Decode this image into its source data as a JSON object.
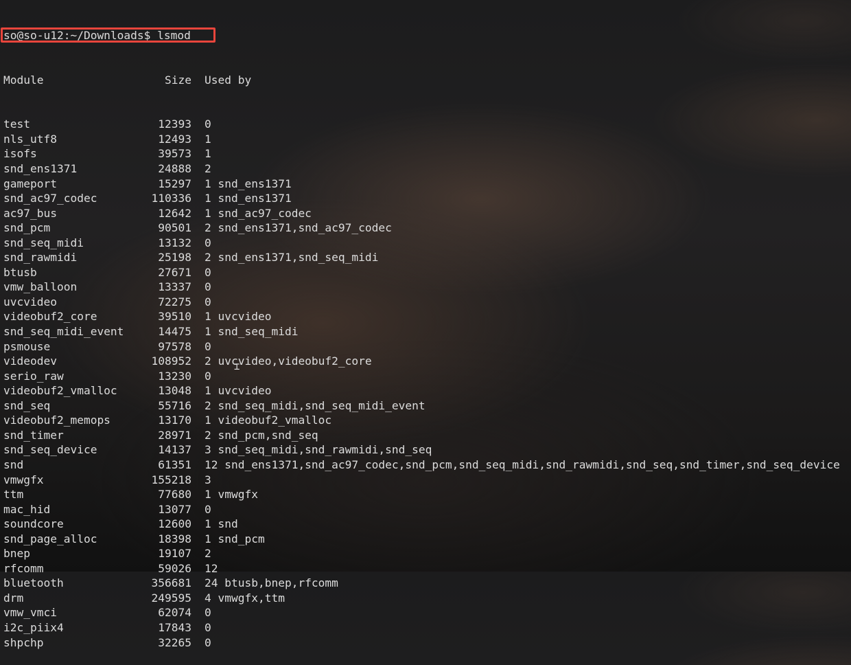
{
  "terminal": {
    "prompt": "so@so-u12:~/Downloads$ lsmod",
    "header": {
      "module": "Module",
      "size": "Size",
      "used_by": "Used by"
    },
    "highlight_color": "#e8453c",
    "rows": [
      {
        "module": "test",
        "size": "12393",
        "used_by": "0"
      },
      {
        "module": "nls_utf8",
        "size": "12493",
        "used_by": "1"
      },
      {
        "module": "isofs",
        "size": "39573",
        "used_by": "1"
      },
      {
        "module": "snd_ens1371",
        "size": "24888",
        "used_by": "2"
      },
      {
        "module": "gameport",
        "size": "15297",
        "used_by": "1 snd_ens1371"
      },
      {
        "module": "snd_ac97_codec",
        "size": "110336",
        "used_by": "1 snd_ens1371"
      },
      {
        "module": "ac97_bus",
        "size": "12642",
        "used_by": "1 snd_ac97_codec"
      },
      {
        "module": "snd_pcm",
        "size": "90501",
        "used_by": "2 snd_ens1371,snd_ac97_codec"
      },
      {
        "module": "snd_seq_midi",
        "size": "13132",
        "used_by": "0"
      },
      {
        "module": "snd_rawmidi",
        "size": "25198",
        "used_by": "2 snd_ens1371,snd_seq_midi"
      },
      {
        "module": "btusb",
        "size": "27671",
        "used_by": "0"
      },
      {
        "module": "vmw_balloon",
        "size": "13337",
        "used_by": "0"
      },
      {
        "module": "uvcvideo",
        "size": "72275",
        "used_by": "0"
      },
      {
        "module": "videobuf2_core",
        "size": "39510",
        "used_by": "1 uvcvideo"
      },
      {
        "module": "snd_seq_midi_event",
        "size": "14475",
        "used_by": "1 snd_seq_midi"
      },
      {
        "module": "psmouse",
        "size": "97578",
        "used_by": "0"
      },
      {
        "module": "videodev",
        "size": "108952",
        "used_by": "2 uvcvideo,videobuf2_core"
      },
      {
        "module": "serio_raw",
        "size": "13230",
        "used_by": "0"
      },
      {
        "module": "videobuf2_vmalloc",
        "size": "13048",
        "used_by": "1 uvcvideo"
      },
      {
        "module": "snd_seq",
        "size": "55716",
        "used_by": "2 snd_seq_midi,snd_seq_midi_event"
      },
      {
        "module": "videobuf2_memops",
        "size": "13170",
        "used_by": "1 videobuf2_vmalloc"
      },
      {
        "module": "snd_timer",
        "size": "28971",
        "used_by": "2 snd_pcm,snd_seq"
      },
      {
        "module": "snd_seq_device",
        "size": "14137",
        "used_by": "3 snd_seq_midi,snd_rawmidi,snd_seq"
      },
      {
        "module": "snd",
        "size": "61351",
        "used_by": "12 snd_ens1371,snd_ac97_codec,snd_pcm,snd_seq_midi,snd_rawmidi,snd_seq,snd_timer,snd_seq_device"
      },
      {
        "module": "vmwgfx",
        "size": "155218",
        "used_by": "3"
      },
      {
        "module": "ttm",
        "size": "77680",
        "used_by": "1 vmwgfx"
      },
      {
        "module": "mac_hid",
        "size": "13077",
        "used_by": "0"
      },
      {
        "module": "soundcore",
        "size": "12600",
        "used_by": "1 snd"
      },
      {
        "module": "snd_page_alloc",
        "size": "18398",
        "used_by": "1 snd_pcm"
      },
      {
        "module": "bnep",
        "size": "19107",
        "used_by": "2"
      },
      {
        "module": "rfcomm",
        "size": "59026",
        "used_by": "12"
      },
      {
        "module": "bluetooth",
        "size": "356681",
        "used_by": "24 btusb,bnep,rfcomm"
      },
      {
        "module": "drm",
        "size": "249595",
        "used_by": "4 vmwgfx,ttm"
      },
      {
        "module": "vmw_vmci",
        "size": "62074",
        "used_by": "0"
      },
      {
        "module": "i2c_piix4",
        "size": "17843",
        "used_by": "0"
      },
      {
        "module": "shpchp",
        "size": "32265",
        "used_by": "0"
      }
    ]
  }
}
